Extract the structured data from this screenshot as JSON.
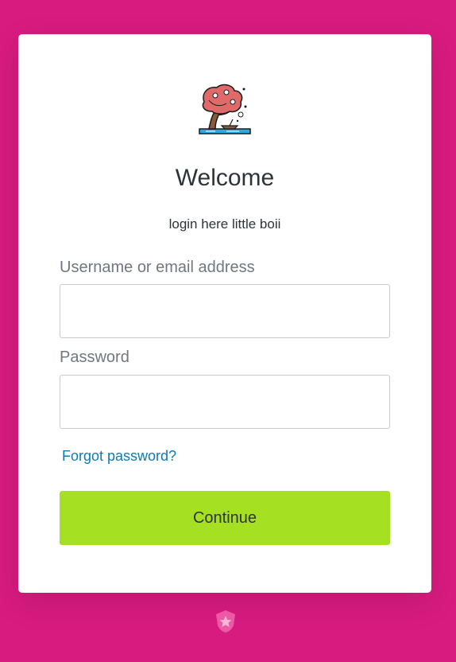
{
  "card": {
    "logo_icon": "cherry-blossom-tree-icon",
    "title": "Welcome",
    "subtitle": "login here little boii"
  },
  "form": {
    "username_label": "Username or email address",
    "username_value": "",
    "password_label": "Password",
    "password_value": "",
    "forgot_password": "Forgot password?",
    "continue_label": "Continue"
  },
  "footer": {
    "badge_icon": "star-shield-icon"
  },
  "colors": {
    "background": "#d81b7f",
    "card": "#ffffff",
    "button": "#a6e022",
    "link": "#0b7cb3",
    "text": "#2d333a",
    "label": "#6f7780"
  }
}
